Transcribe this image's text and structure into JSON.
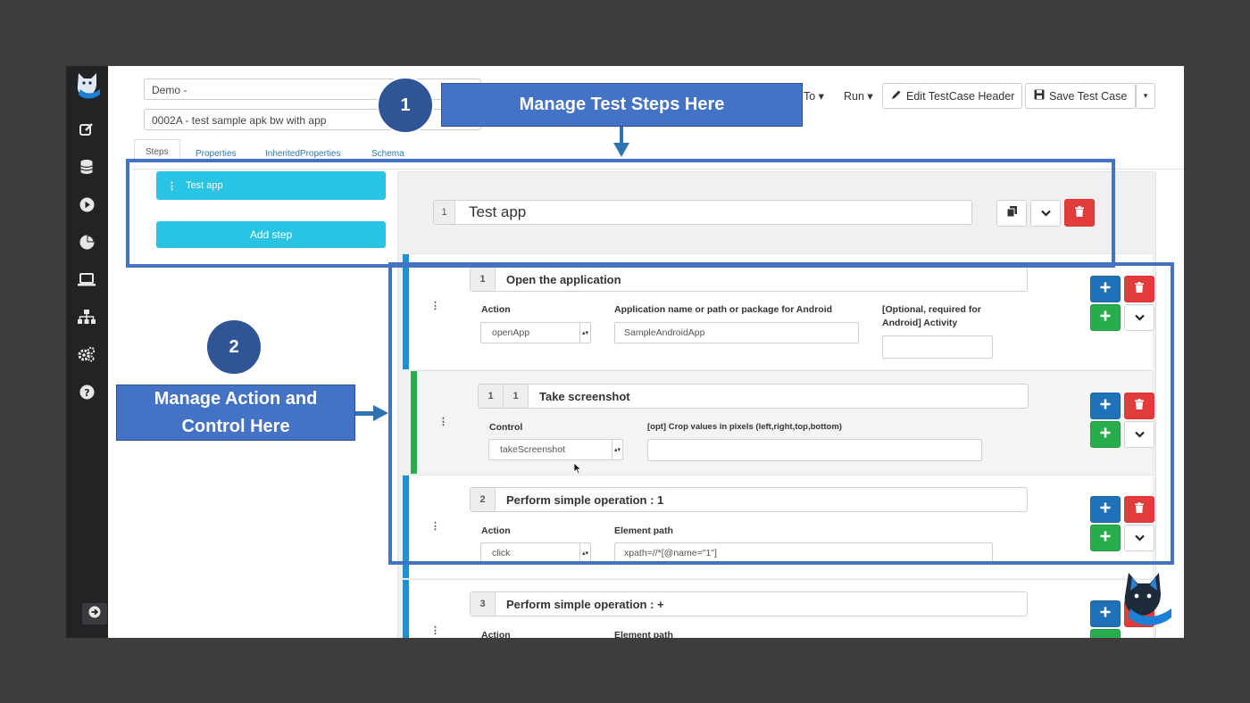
{
  "header": {
    "environment_select": "Demo -",
    "testcase_select": "0002A - test sample apk bw with app",
    "goto_label": "To",
    "run_label": "Run",
    "edit_header_label": "Edit TestCase Header",
    "save_label": "Save Test Case"
  },
  "tabs": [
    "Steps",
    "Properties",
    "InheritedProperties",
    "Schema"
  ],
  "steps_panel": {
    "step_item": "Test app",
    "add_step_label": "Add step"
  },
  "step_title": {
    "number": "1",
    "title": "Test app"
  },
  "actions": [
    {
      "number": "1",
      "description": "Open the application",
      "action_label": "Action",
      "action_value": "openApp",
      "field1_label": "Application name or path or package for Android",
      "field1_value": "SampleAndroidApp",
      "field2_label_line1": "[Optional, required for",
      "field2_label_line2": "Android] Activity",
      "field2_value": ""
    },
    {
      "number": "2",
      "description": "Perform simple operation : 1",
      "action_label": "Action",
      "action_value": "click",
      "field1_label": "Element path",
      "field1_value": "xpath=//*[@name=\"1\"]"
    },
    {
      "number": "3",
      "description": "Perform simple operation : +",
      "action_label": "Action",
      "field1_label": "Element path"
    }
  ],
  "control": {
    "number_a": "1",
    "number_b": "1",
    "description": "Take screenshot",
    "control_label": "Control",
    "control_value": "takeScreenshot",
    "crop_label": "[opt] Crop values in pixels (left,right,top,bottom)",
    "crop_value": ""
  },
  "annotations": {
    "circle1": "1",
    "banner1": "Manage Test Steps Here",
    "circle2": "2",
    "banner2_line1": "Manage Action and",
    "banner2_line2": "Control Here"
  },
  "colors": {
    "annotation_blue": "#4472c4",
    "pill_cyan": "#29c4e3",
    "danger_red": "#e23b3b",
    "add_blue": "#1f72b8",
    "add_green": "#27ad4b",
    "sidebar": "#222325"
  },
  "icons": [
    "logo-icon",
    "edit-icon",
    "database-icon",
    "play-icon",
    "pie-chart-icon",
    "laptop-icon",
    "sitemap-icon",
    "gears-icon",
    "help-icon",
    "arrow-right-icon",
    "pencil-icon",
    "save-icon",
    "copy-icon",
    "chevron-down-icon",
    "trash-icon",
    "plus-icon"
  ]
}
